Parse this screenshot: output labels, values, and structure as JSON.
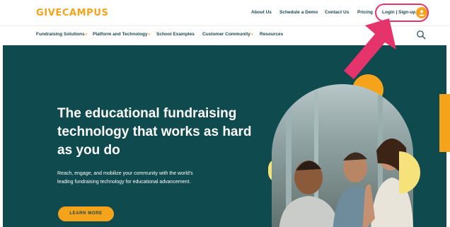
{
  "brand": {
    "logo": "GIVECAMPUS",
    "accent": "#f5a31a",
    "dark": "#0f4a4f"
  },
  "utility_nav": {
    "items": [
      "About Us",
      "Schedule a Demo",
      "Contact Us",
      "Pricing"
    ],
    "login": "Login | Sign-up"
  },
  "main_nav": {
    "items": [
      {
        "label": "Fundraising Solutions",
        "has_dropdown": true
      },
      {
        "label": "Platform and Technology",
        "has_dropdown": true
      },
      {
        "label": "School Examples",
        "has_dropdown": false
      },
      {
        "label": "Customer Community",
        "has_dropdown": true
      },
      {
        "label": "Resources",
        "has_dropdown": false
      }
    ],
    "search_icon": "search-icon"
  },
  "hero": {
    "headline": "The educational fundraising technology that works as hard as you do",
    "subtext": "Reach, engage, and mobilize your community with the world's leading fundraising technology for educational advancement.",
    "cta": "LEARN MORE"
  },
  "annotation": {
    "color": "#e5336b",
    "icon": "pointer-arrow-icon"
  }
}
